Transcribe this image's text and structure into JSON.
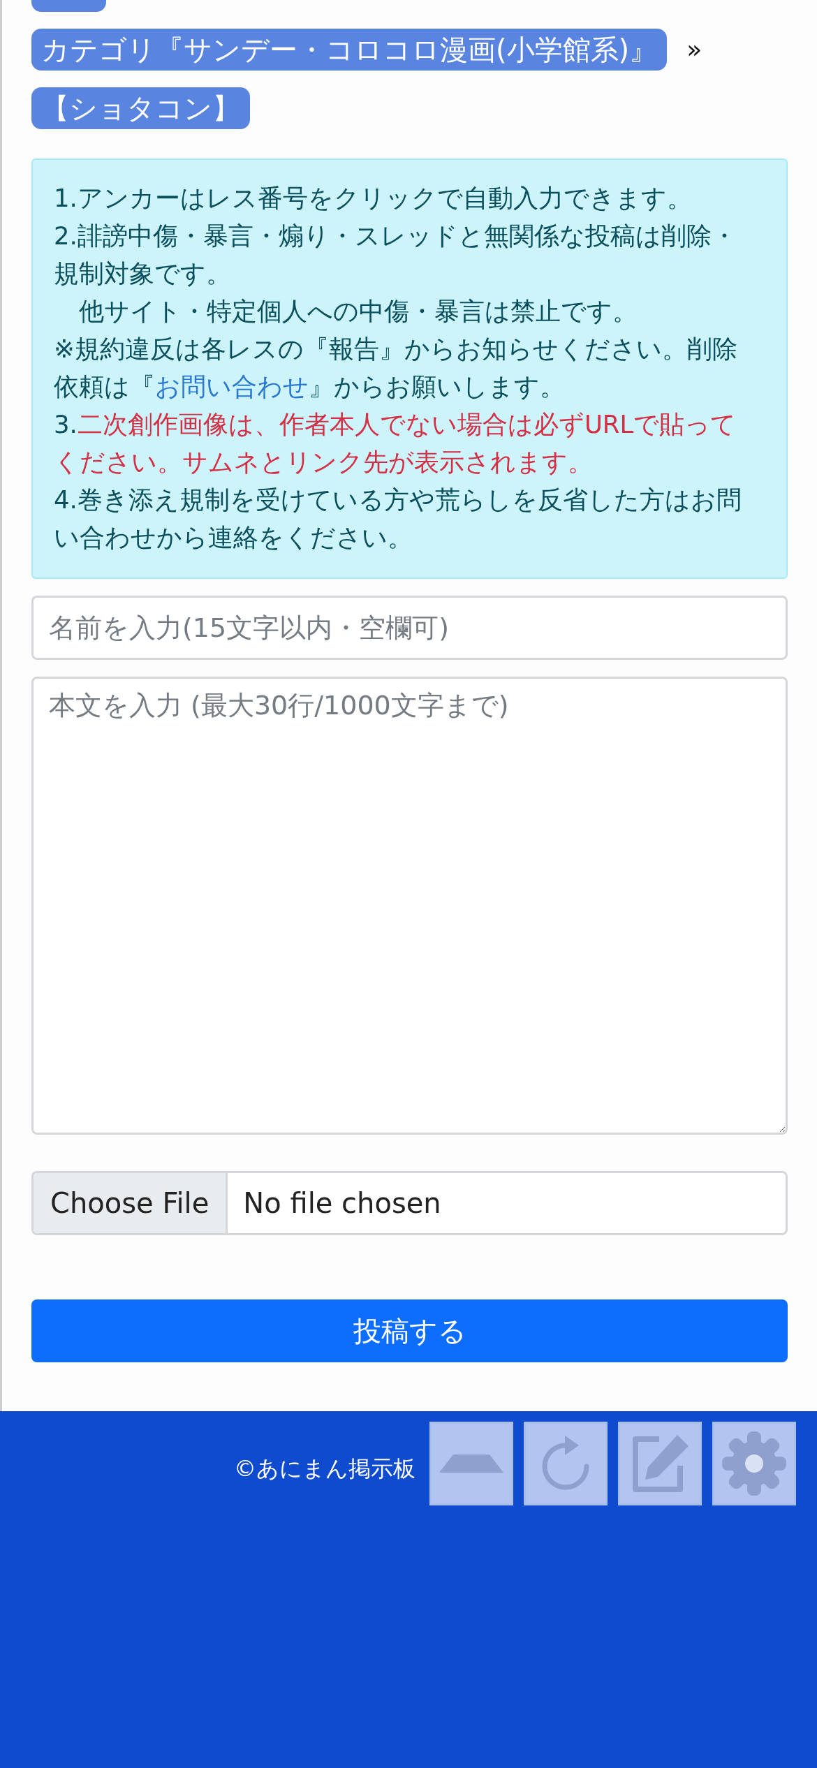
{
  "breadcrumbs": [
    {
      "label": "カテゴリ『サンデー・コロコロ漫画(小学館系)』"
    },
    {
      "label": "【ショタコン】"
    }
  ],
  "breadcrumb_separator": "»",
  "notice": [
    [
      {
        "kind": "plain",
        "text": "1.アンカーはレス番号をクリックで自動入力できます。"
      }
    ],
    [
      {
        "kind": "plain",
        "text": "2.誹謗中傷・暴言・煽り・スレッドと無関係な投稿は削除・規制対象です。"
      }
    ],
    [
      {
        "kind": "plain",
        "text": "　他サイト・特定個人への中傷・暴言は禁止です。"
      }
    ],
    [
      {
        "kind": "plain",
        "text": "※規約違反は各レスの『報告』からお知らせください。削除依頼は『"
      },
      {
        "kind": "link",
        "text": "お問い合わせ"
      },
      {
        "kind": "plain",
        "text": "』からお願いします。"
      }
    ],
    [
      {
        "kind": "plain",
        "text": "3."
      },
      {
        "kind": "warning",
        "text": "二次創作画像は、作者本人でない場合は必ずURLで貼ってください。サムネとリンク先が表示されます。"
      }
    ],
    [
      {
        "kind": "plain",
        "text": "4.巻き添え規制を受けている方や荒らしを反省した方はお問い合わせから連絡をください。"
      }
    ]
  ],
  "form": {
    "name": {
      "placeholder": "名前を入力(15文字以内・空欄可)"
    },
    "body": {
      "placeholder": "本文を入力 (最大30行/1000文字まで)"
    },
    "file": {
      "button": "Choose File",
      "status": "No file chosen"
    },
    "submit": "投稿する"
  },
  "footer": {
    "copyright": "©あにまん掲示板"
  }
}
